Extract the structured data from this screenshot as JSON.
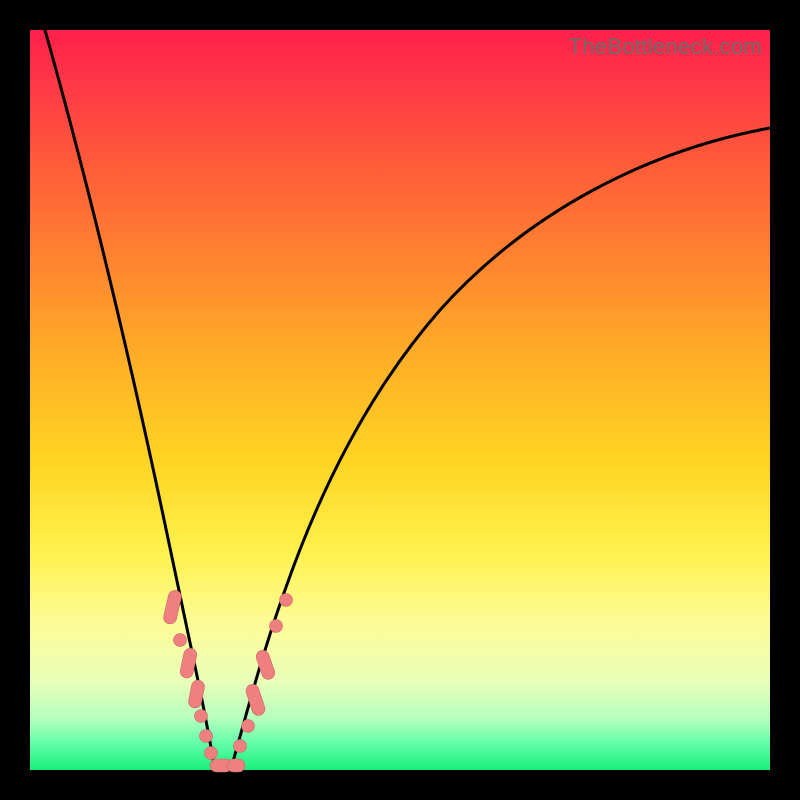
{
  "watermark": "TheBottleneck.com",
  "colors": {
    "frame": "#000000",
    "curve": "#000000",
    "marker_fill": "#f08080",
    "marker_stroke": "#c46868",
    "watermark_text": "#6a6a6a"
  },
  "chart_data": {
    "type": "line",
    "title": "",
    "xlabel": "",
    "ylabel": "",
    "xlim": [
      0,
      100
    ],
    "ylim": [
      0,
      100
    ],
    "grid": false,
    "legend": false,
    "description": "Bottleneck curve: two branches converging to a minimum near x≈24; value ≈0 at the minimum and rises steeply toward 100 away from it.",
    "series": [
      {
        "name": "left-branch",
        "x": [
          0,
          4,
          8,
          12,
          16,
          19,
          21,
          22.5,
          24
        ],
        "y": [
          100,
          84,
          68,
          52,
          36,
          22,
          12,
          5,
          0
        ]
      },
      {
        "name": "right-branch",
        "x": [
          24,
          26,
          28,
          31,
          35,
          40,
          48,
          58,
          70,
          85,
          100
        ],
        "y": [
          0,
          5,
          12,
          22,
          33,
          45,
          58,
          69,
          78,
          84,
          87
        ]
      }
    ],
    "markers": [
      {
        "branch": "left",
        "x": 19.0,
        "y": 22,
        "shape": "capsule"
      },
      {
        "branch": "left",
        "x": 20.0,
        "y": 17,
        "shape": "dot"
      },
      {
        "branch": "left",
        "x": 20.8,
        "y": 13,
        "shape": "capsule"
      },
      {
        "branch": "left",
        "x": 21.6,
        "y": 9,
        "shape": "capsule"
      },
      {
        "branch": "left",
        "x": 22.3,
        "y": 6,
        "shape": "dot"
      },
      {
        "branch": "left",
        "x": 23.0,
        "y": 3,
        "shape": "dot"
      },
      {
        "branch": "left",
        "x": 23.6,
        "y": 1,
        "shape": "dot"
      },
      {
        "branch": "floor",
        "x": 24.5,
        "y": 0,
        "shape": "capsule"
      },
      {
        "branch": "floor",
        "x": 26.0,
        "y": 0,
        "shape": "capsule"
      },
      {
        "branch": "right",
        "x": 27.0,
        "y": 3,
        "shape": "dot"
      },
      {
        "branch": "right",
        "x": 28.0,
        "y": 7,
        "shape": "dot"
      },
      {
        "branch": "right",
        "x": 29.2,
        "y": 12,
        "shape": "capsule"
      },
      {
        "branch": "right",
        "x": 30.5,
        "y": 17,
        "shape": "capsule"
      },
      {
        "branch": "right",
        "x": 31.8,
        "y": 21,
        "shape": "dot"
      },
      {
        "branch": "right",
        "x": 33.0,
        "y": 25,
        "shape": "dot"
      }
    ]
  }
}
